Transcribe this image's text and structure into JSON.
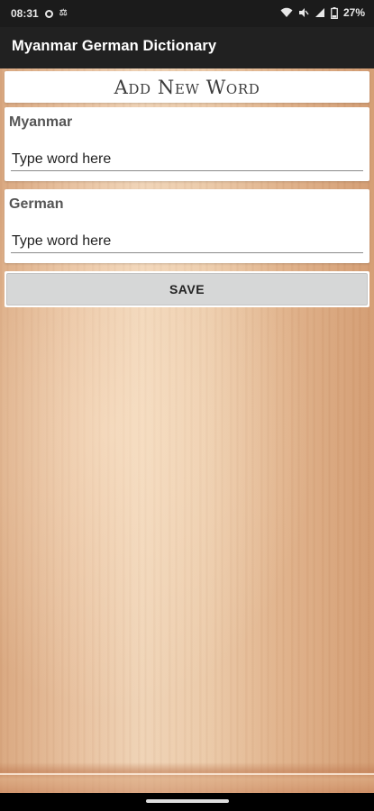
{
  "status_bar": {
    "time": "08:31",
    "battery_percent": "27%",
    "icons": [
      "circle-icon",
      "bike-icon",
      "wifi-icon",
      "mute-icon",
      "signal-icon",
      "battery-icon"
    ]
  },
  "app_bar": {
    "title": "Myanmar German Dictionary"
  },
  "header": {
    "title": "Add New Word"
  },
  "fields": [
    {
      "label": "Myanmar",
      "placeholder": "Type word here",
      "value": ""
    },
    {
      "label": "German",
      "placeholder": "Type word here",
      "value": ""
    }
  ],
  "save_button": {
    "label": "SAVE"
  },
  "colors": {
    "app_bar": "#212121",
    "status_bar": "#1b1b1b",
    "button": "#d6d7d7",
    "card": "#ffffff"
  }
}
